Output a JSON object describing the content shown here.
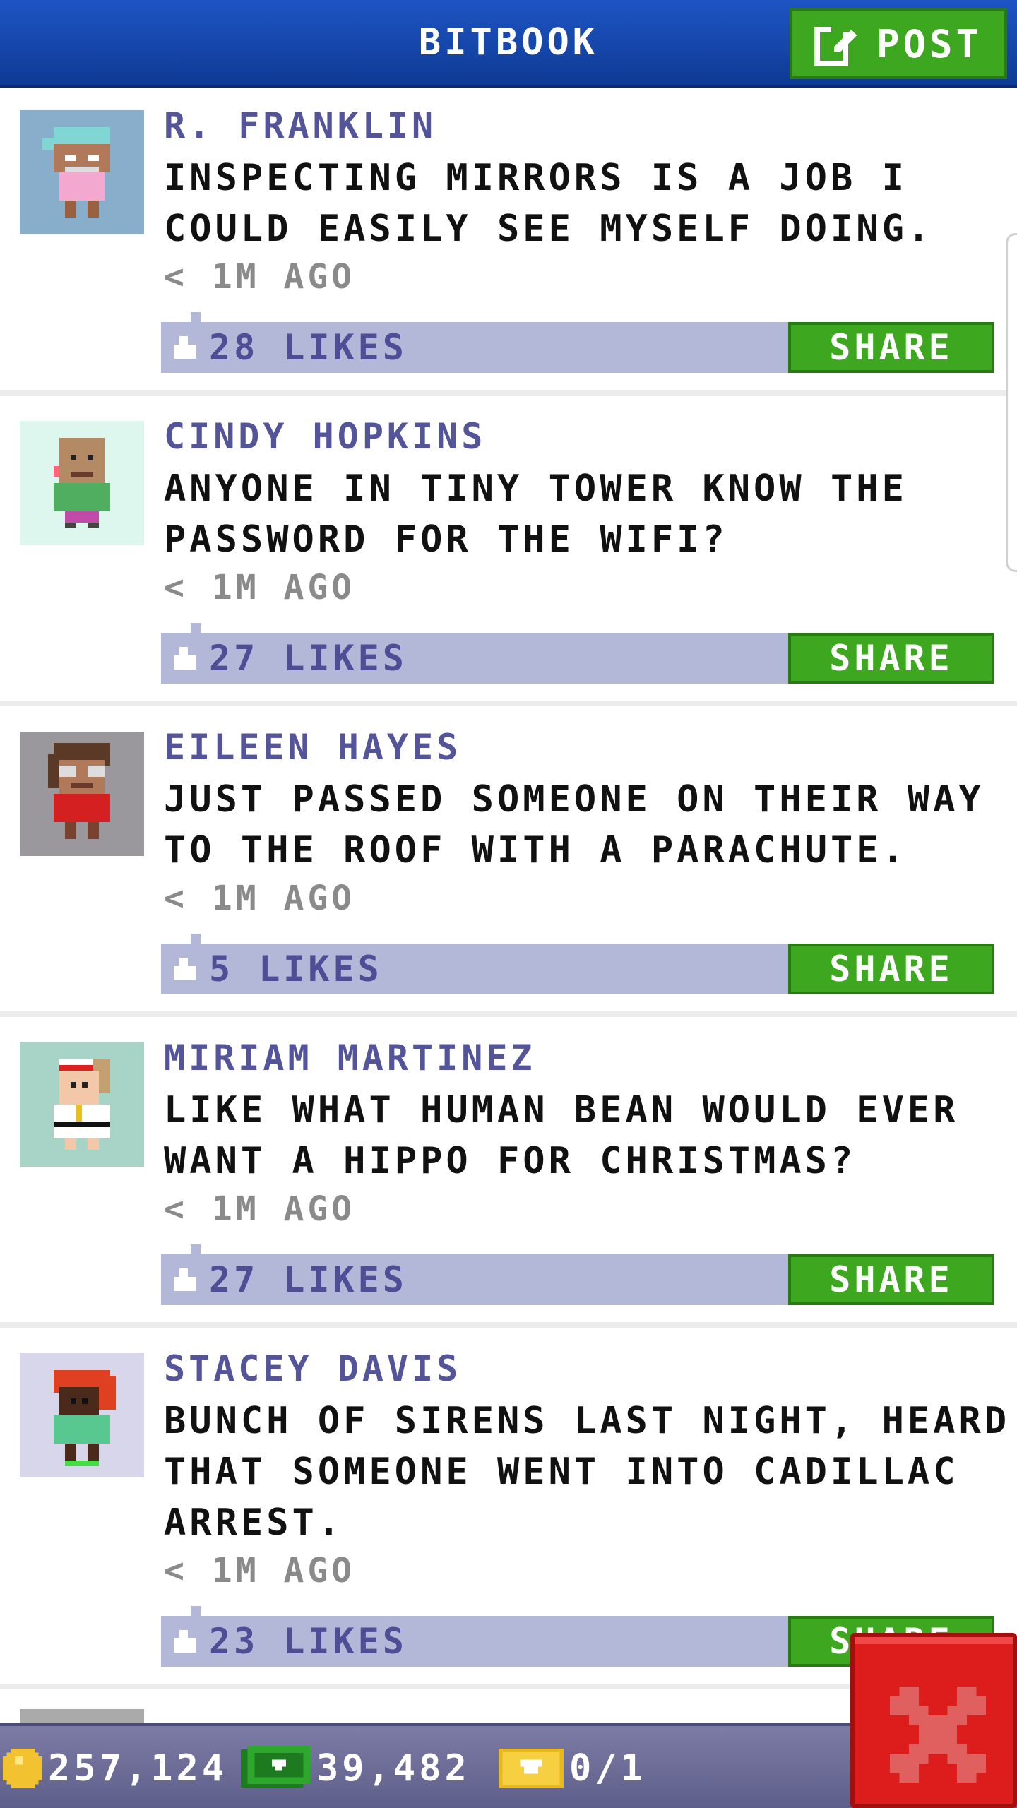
{
  "header": {
    "title": "BITBOOK",
    "post_label": "POST",
    "colors": {
      "bar": "#1e55c4",
      "button": "#3da81f"
    }
  },
  "posts": [
    {
      "author": "R. FRANKLIN",
      "message": "INSPECTING MIRRORS IS A JOB I COULD EASILY SEE MYSELF DOING.",
      "time": "< 1M AGO",
      "likes": "28 LIKES",
      "share_label": "SHARE",
      "avatar_icon": "bitizen-cap-avatar-icon"
    },
    {
      "author": "CINDY HOPKINS",
      "message": "ANYONE IN TINY TOWER KNOW THE PASSWORD FOR THE WIFI?",
      "time": "< 1M AGO",
      "likes": "27 LIKES",
      "share_label": "SHARE",
      "avatar_icon": "bitizen-avatar-icon"
    },
    {
      "author": "EILEEN HAYES",
      "message": "JUST PASSED SOMEONE ON THEIR WAY TO THE ROOF WITH A PARACHUTE.",
      "time": "< 1M AGO",
      "likes": "5 LIKES",
      "share_label": "SHARE",
      "avatar_icon": "bitizen-glasses-avatar-icon"
    },
    {
      "author": "MIRIAM MARTINEZ",
      "message": "LIKE WHAT HUMAN BEAN WOULD EVER WANT A HIPPO FOR CHRISTMAS?",
      "time": "< 1M AGO",
      "likes": "27 LIKES",
      "share_label": "SHARE",
      "avatar_icon": "bitizen-karate-avatar-icon"
    },
    {
      "author": "STACEY DAVIS",
      "message": "BUNCH OF SIRENS LAST NIGHT, HEARD THAT SOMEONE WENT INTO CADILLAC ARREST.",
      "time": "< 1M AGO",
      "likes": "23 LIKES",
      "share_label": "SHARE",
      "avatar_icon": "bitizen-redhair-avatar-icon"
    }
  ],
  "bottom_bar": {
    "coins": "257,124",
    "bux": "39,482",
    "tickets": "0/1",
    "coin_icon": "coin-icon",
    "bux_icon": "bux-icon",
    "ticket_icon": "ticket-icon"
  },
  "close_icon": "close-icon"
}
